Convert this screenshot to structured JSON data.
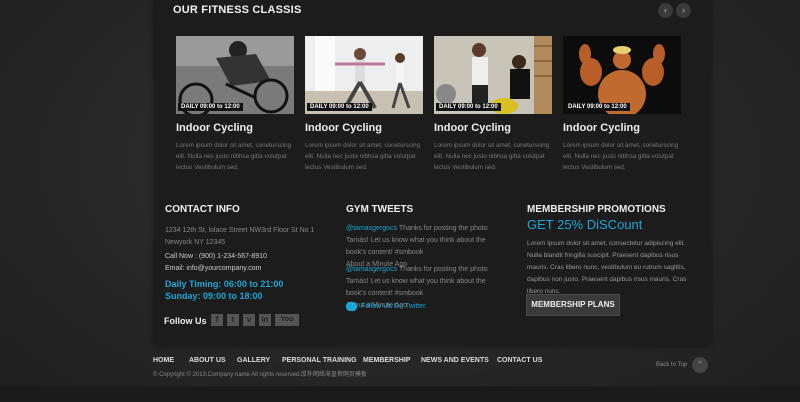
{
  "classes": {
    "heading": "OUR FITNESS CLASSIS",
    "cards": [
      {
        "title": "Indoor Cycling",
        "timing": "DAILY 09:00 to 12:00",
        "desc": "Lorem ipsum dolor sit amet, coneturscing elit. Nulla nec justo nibhsa gitta volutpat lectus Vestibulum sed."
      },
      {
        "title": "Indoor Cycling",
        "timing": "DAILY 09:00 to 12:00",
        "desc": "Lorem ipsum dolor sit amet, coneturscing elit. Nulla nec justo nibhsa gitta volutpat lectus Vestibulum sed."
      },
      {
        "title": "Indoor Cycling",
        "timing": "DAILY 09:00 to 12:00",
        "desc": "Lorem ipsum dolor sit amet, coneturscing elit. Nulla nec justo nibhsa gitta volutpat lectus Vestibulum sed."
      },
      {
        "title": "Indoor Cycling",
        "timing": "DAILY 09:00 to 12:00",
        "desc": "Lorem ipsum dolor sit amet, coneturscing elit. Nulla nec justo nibhsa gitta volutpat lectus Vestibulum sed."
      }
    ]
  },
  "contact": {
    "heading": "CONTACT INFO",
    "address1": "1234 12th St, lolace Street NW3rd Floor St No 1",
    "address2": "Newyork NY 12345",
    "call": "Call Now : (900) 1-234-567-8910",
    "email": "Email: info@yourcompany.com",
    "timing": "Daily Timing: 06:00 to 21:00",
    "sunday": "Sunday: 09:00 to 18:00",
    "follow": "Follow Us"
  },
  "tweets": {
    "heading": "GYM TWEETS",
    "items": [
      {
        "handle": "@tamasgergocs",
        "text": "Thanks for posting the photo Tamás! Let us know what you think about the book's content! #smbook",
        "time": "About a Minute Ago"
      },
      {
        "handle": "@tamasgergocs",
        "text": "Thanks for posting the photo Tamás! Let us know what you think about the book's content! #smbook",
        "time": "About a Minute Ago"
      }
    ],
    "follow": "Follow Us On Twitter"
  },
  "membership": {
    "heading": "MEMBERSHIP PROMOTIONS",
    "offer": "GET 25% DiSCount",
    "desc": "Lorem ipsum dolor sit amet, consectetur adipiscing elit. Nulla blandit fringilla suscipit. Praesent dapibus risus mauris. Cras libero nunc, vestibulum eu rutrum sagittis, dapibus non justo. Praesent dapibus risus mauris. Cras libero nunc.",
    "button": "MEMBERSHIP PLANS"
  },
  "footer": {
    "nav": [
      "HOME",
      "ABOUT US",
      "GALLERY",
      "PERSONAL TRAINING",
      "MEMBERSHIP",
      "NEWS AND EVENTS",
      "CONTACT US"
    ],
    "copyright": "© Copyright © 2013.Company name All rights reserved.厚朴网络海皇帝网页模板",
    "back": "Back to Top"
  },
  "colors": {
    "accent": "#1ca6d6"
  }
}
